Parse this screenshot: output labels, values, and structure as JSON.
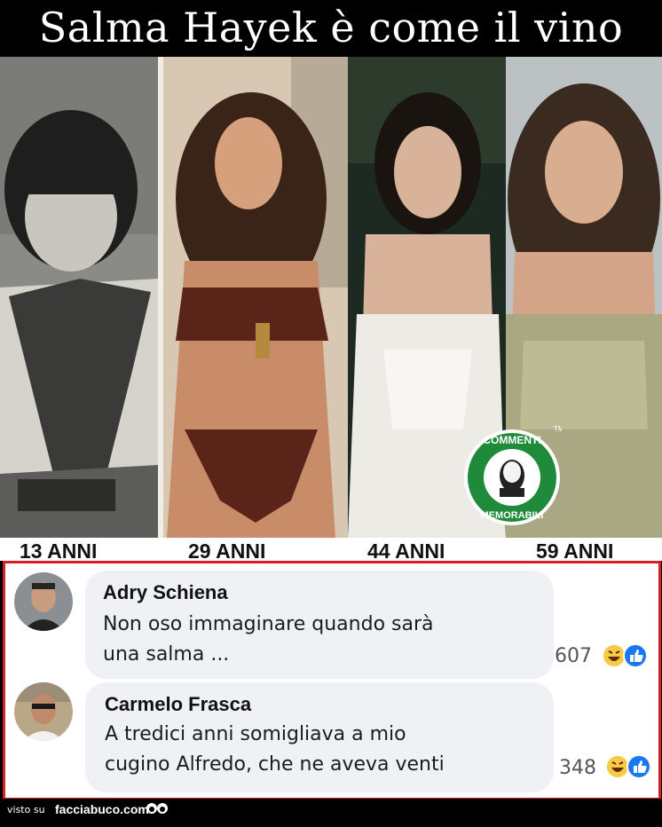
{
  "header": {
    "title": "Salma Hayek è come il vino"
  },
  "photos": [
    {
      "age_label": "13 ANNI"
    },
    {
      "age_label": "29 ANNI"
    },
    {
      "age_label": "44 ANNI"
    },
    {
      "age_label": "59 ANNI"
    }
  ],
  "badge": {
    "top": "COMMENTI",
    "bottom": "MEMORABILI",
    "tm": "TM"
  },
  "comments": [
    {
      "author": "Adry Schiena",
      "lines": [
        "Non oso immaginare quando sarà",
        "una salma ..."
      ],
      "reactions": "607"
    },
    {
      "author": "Carmelo Frasca",
      "lines": [
        "A tredici anni somigliava a mio",
        "cugino Alfredo, che ne aveva venti"
      ],
      "reactions": "348"
    }
  ],
  "footer": {
    "prefix": "visto su",
    "site": "facciabuco.com"
  },
  "colors": {
    "highlight_border": "#d81f26",
    "badge_green": "#1f8a3a",
    "like_blue": "#1877f2",
    "haha_yellow": "#f7c944"
  }
}
